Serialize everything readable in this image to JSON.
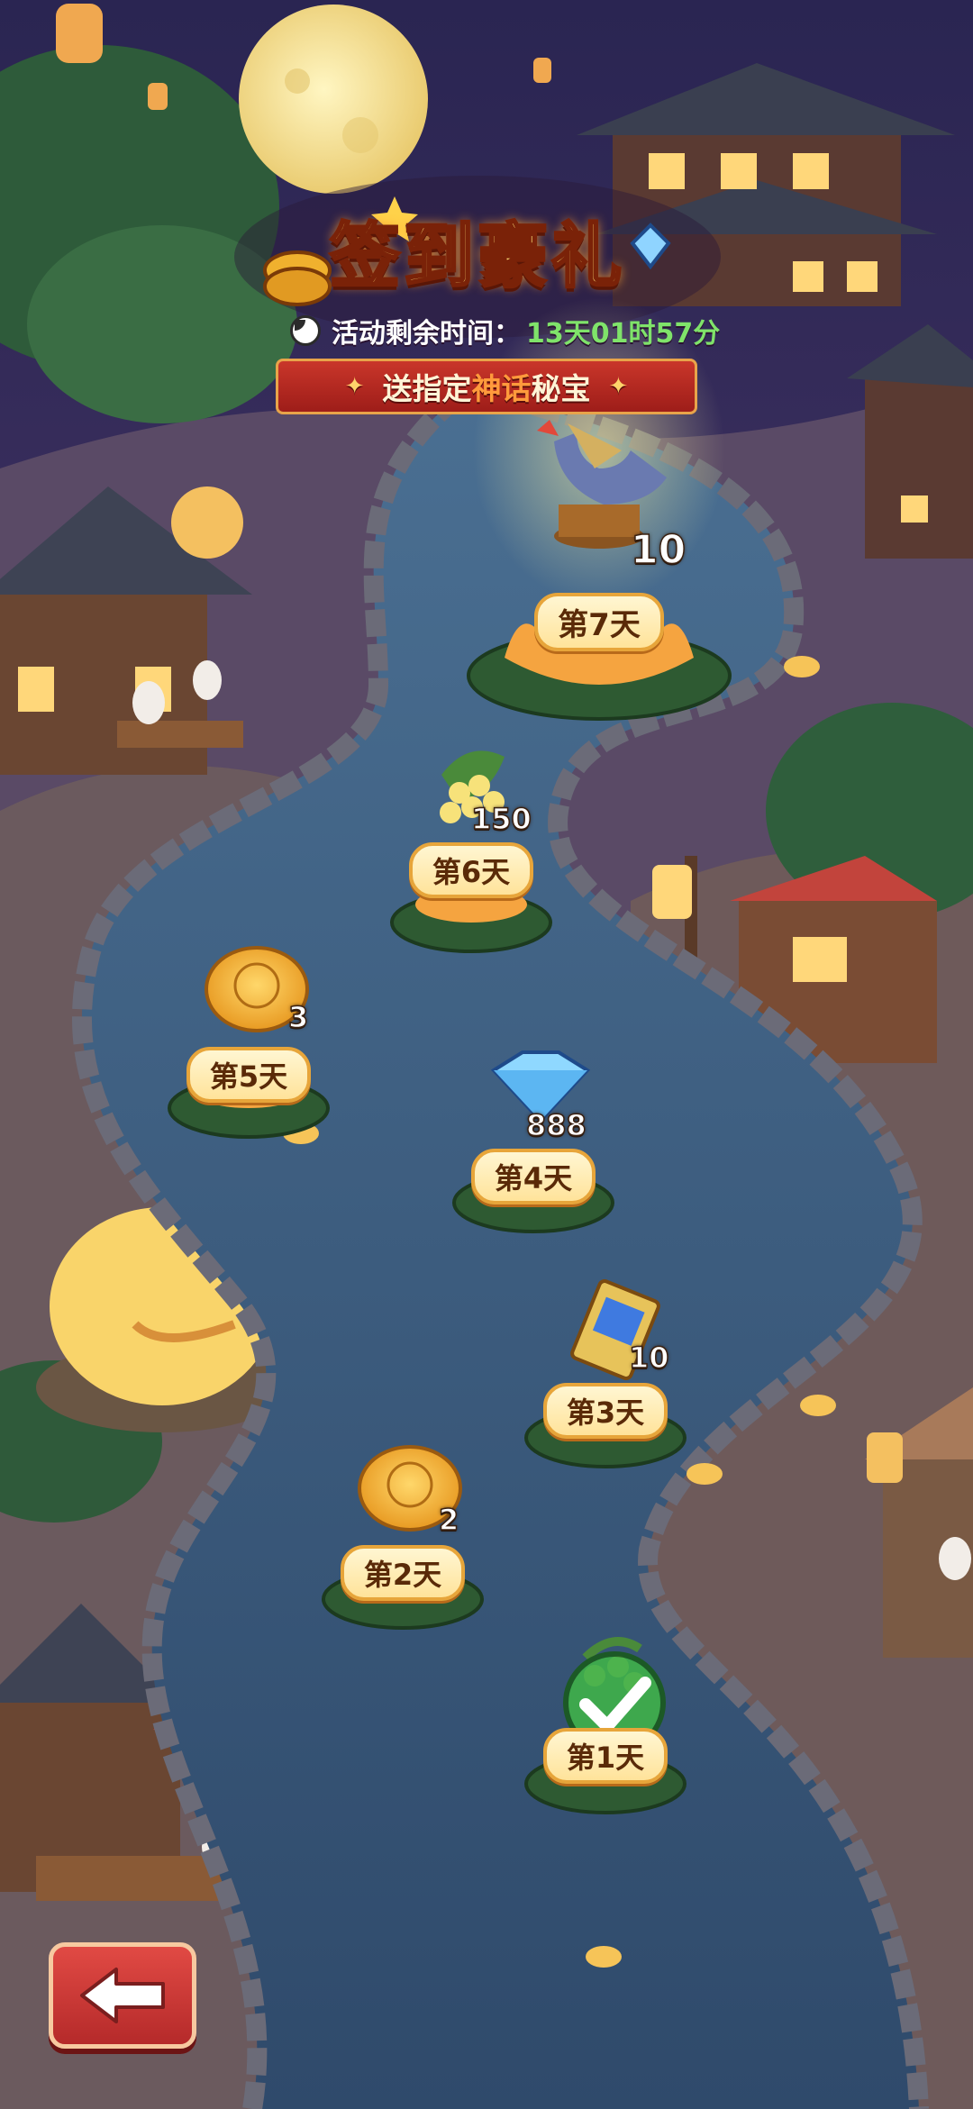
{
  "header": {
    "title": "签到豪礼",
    "timer_label": "活动剩余时间：",
    "timer_value": "13天01时57分",
    "ribbon_prefix": "送指定",
    "ribbon_highlight": "神话",
    "ribbon_suffix": "秘宝"
  },
  "days": [
    {
      "label": "第1天",
      "claimed": true,
      "icon": "osmanthus-flower-icon",
      "qty": ""
    },
    {
      "label": "第2天",
      "claimed": false,
      "icon": "mooncake-icon",
      "qty": "2"
    },
    {
      "label": "第3天",
      "claimed": false,
      "icon": "ticket-icon",
      "qty": "10"
    },
    {
      "label": "第4天",
      "claimed": false,
      "icon": "diamond-icon",
      "qty": "888"
    },
    {
      "label": "第5天",
      "claimed": false,
      "icon": "mooncake-icon",
      "qty": "3"
    },
    {
      "label": "第6天",
      "claimed": false,
      "icon": "osmanthus-flower-icon",
      "qty": "150"
    },
    {
      "label": "第7天",
      "claimed": false,
      "icon": "horn-artifact-icon",
      "qty": "10"
    }
  ],
  "colors": {
    "title_gold": "#ffe27a",
    "timer_green": "#7fe36a",
    "ribbon_red": "#c9362a",
    "river_blue": "#3b5f86",
    "plate_cream": "#fff3c8",
    "check_green": "#3fb04a",
    "back_button_red": "#d93c3a"
  }
}
